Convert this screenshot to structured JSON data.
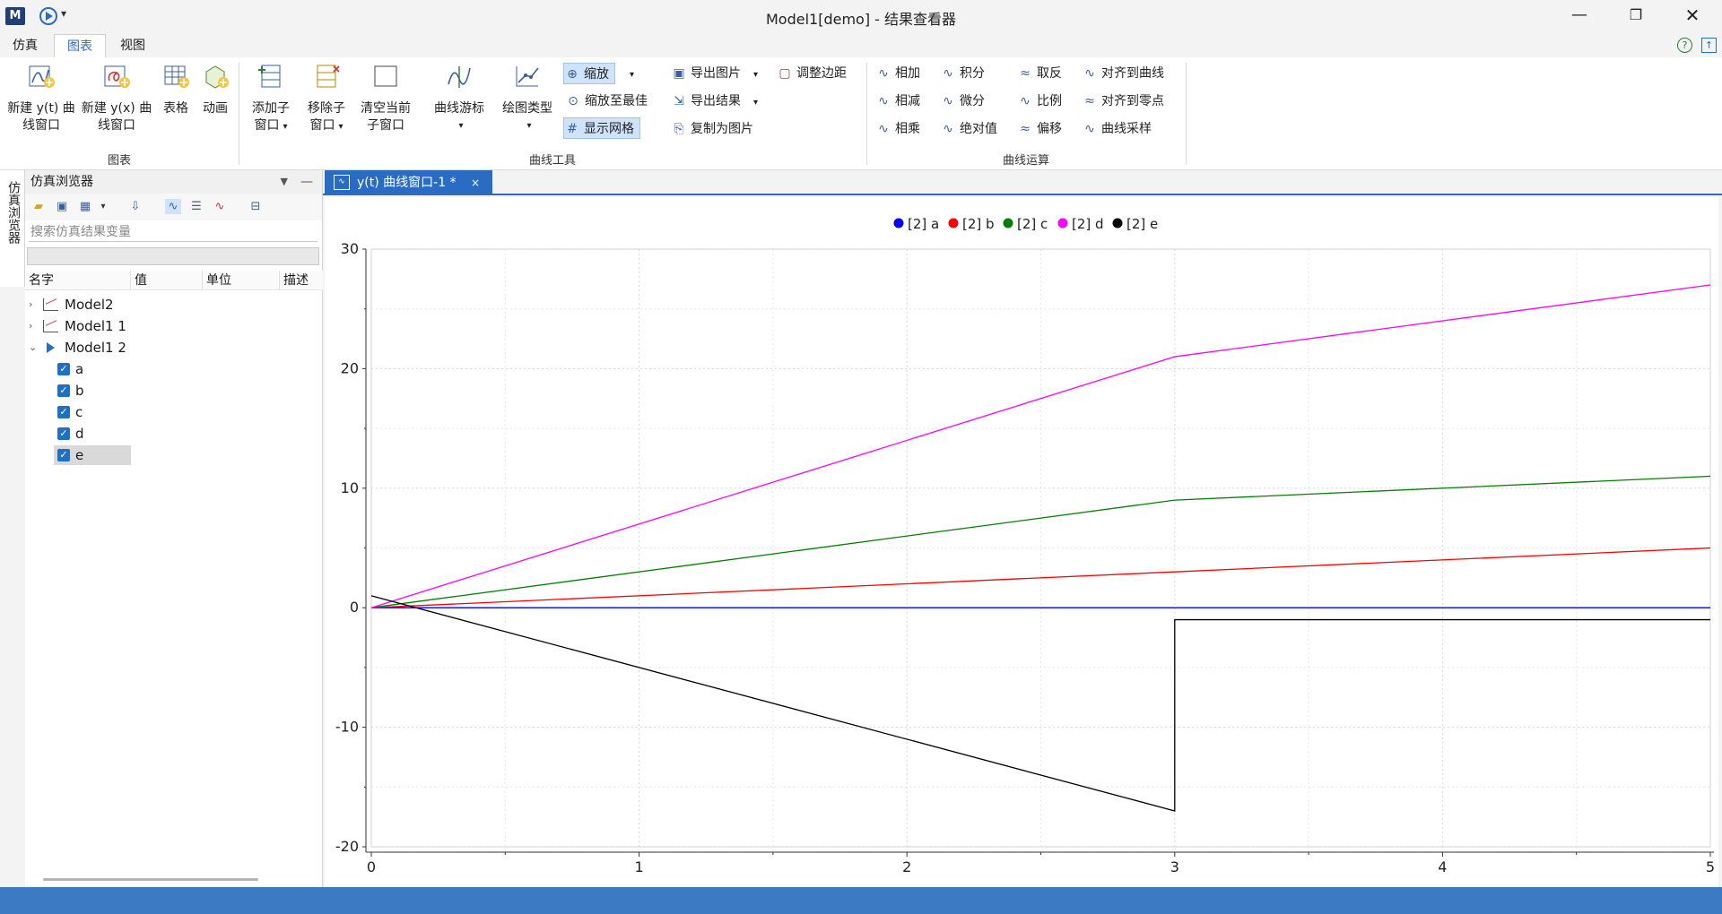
{
  "window": {
    "title": "Model1[demo] - 结果查看器",
    "logo": "M"
  },
  "menu": {
    "tabs": [
      {
        "label": "仿真"
      },
      {
        "label": "图表"
      },
      {
        "label": "视图"
      }
    ]
  },
  "ribbon": {
    "groups": {
      "chart": "图表",
      "curve_tools": "曲线工具",
      "curve_ops": "曲线运算"
    },
    "chart_buttons": {
      "new_yt": [
        "新建 y(t) 曲",
        "线窗口"
      ],
      "new_yx": [
        "新建 y(x) 曲",
        "线窗口"
      ],
      "table": "表格",
      "animation": "动画",
      "add_sub": [
        "添加子",
        "窗口"
      ],
      "remove_sub": [
        "移除子",
        "窗口"
      ],
      "clear_sub": [
        "清空当前",
        "子窗口"
      ]
    },
    "tool_buttons": {
      "cursor": "曲线游标",
      "plot_type": "绘图类型",
      "zoom": "缩放",
      "zoom_fit": "缩放至最佳",
      "show_grid": "显示网格",
      "export_image": "导出图片",
      "export_result": "导出结果",
      "copy_image": "复制为图片",
      "adjust_margin": "调整边距"
    },
    "op_buttons": {
      "add": "相加",
      "subtract": "相减",
      "multiply": "相乘",
      "integral": "积分",
      "derivative": "微分",
      "abs": "绝对值",
      "negate": "取反",
      "ratio": "比例",
      "offset": "偏移",
      "align_curve": "对齐到曲线",
      "align_zero": "对齐到零点",
      "resample": "曲线采样"
    }
  },
  "side_tab": "仿真浏览器",
  "browser": {
    "title": "仿真浏览器",
    "search_placeholder": "搜索仿真结果变量",
    "columns": [
      "名字",
      "值",
      "单位",
      "描述"
    ],
    "tree": [
      {
        "label": "Model2",
        "expanded": false
      },
      {
        "label": "Model1 1",
        "expanded": false
      },
      {
        "label": "Model1 2",
        "expanded": true
      }
    ],
    "variables": [
      "a",
      "b",
      "c",
      "d",
      "e"
    ],
    "selected_variable": "e"
  },
  "doc_tab": {
    "label": "y(t) 曲线窗口-1 *",
    "close": "×"
  },
  "chart_data": {
    "type": "line",
    "xlim": [
      0,
      5
    ],
    "ylim": [
      -20,
      30
    ],
    "xticks": [
      0,
      1,
      2,
      3,
      4,
      5
    ],
    "yticks": [
      30,
      20,
      10,
      0,
      -10,
      -20
    ],
    "grid": true,
    "legend_position": "top-center",
    "series": [
      {
        "name": "[2] a",
        "color": "#0000ff",
        "x": [
          0,
          3,
          5
        ],
        "y": [
          0,
          0,
          0
        ],
        "marker": "●"
      },
      {
        "name": "[2] b",
        "color": "#ff0000",
        "x": [
          0,
          3,
          5
        ],
        "y": [
          0,
          3,
          5
        ],
        "marker": "●"
      },
      {
        "name": "[2] c",
        "color": "#008000",
        "x": [
          0,
          3,
          5
        ],
        "y": [
          0,
          9,
          11
        ],
        "marker": "●"
      },
      {
        "name": "[2] d",
        "color": "#ff00ff",
        "x": [
          0,
          3,
          5
        ],
        "y": [
          0,
          21,
          27
        ],
        "marker": "●"
      },
      {
        "name": "[2] e",
        "color": "#000000",
        "x": [
          0,
          3,
          3,
          5
        ],
        "y": [
          1,
          -17,
          -1,
          -1
        ],
        "marker": "●"
      }
    ]
  }
}
